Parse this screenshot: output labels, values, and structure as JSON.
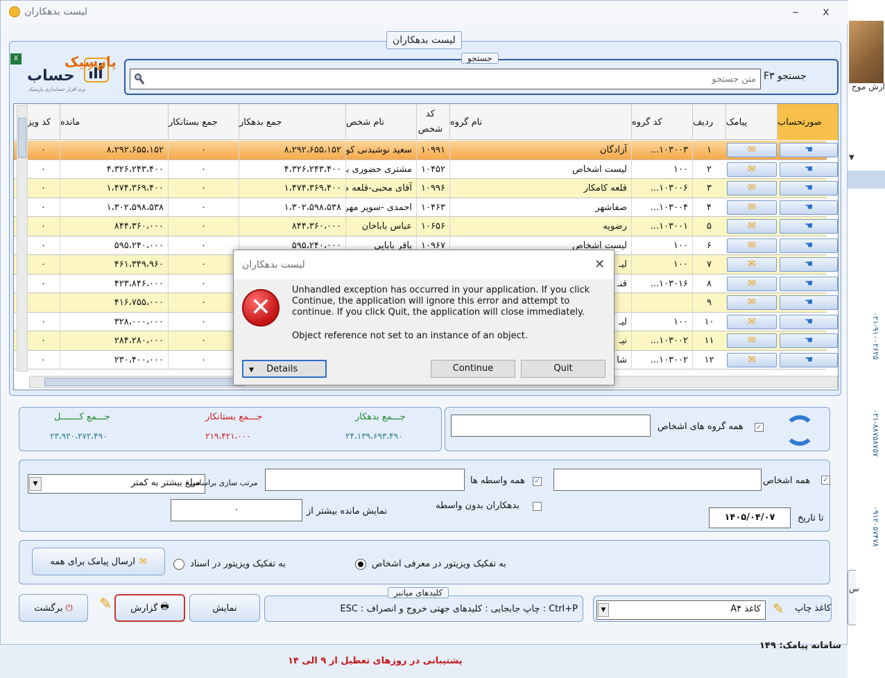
{
  "window": {
    "title": "لیست بدهکاران",
    "min": "–",
    "close": "x"
  },
  "side": {
    "text1": "ارش موج",
    "num1": "۰۲۱-۹۱۰۰۲۶۲۵",
    "num2": "۰۲۱-۸۸۷۵۸۷۵۷",
    "num3": "۰۹۱۲۰۵۷۴۷۸",
    "s": "س"
  },
  "logo": {
    "word1": "پارسیک",
    "word2": "حساب",
    "tag": "نرم افزار حسابداری پارسیک"
  },
  "group": {
    "list_title": "لیست بدهکاران",
    "search_title": "جستجو"
  },
  "search": {
    "label": "جستجو F۳",
    "placeholder": "متن جستجو"
  },
  "columns": [
    "صورتحساب",
    "پیامک",
    "ردیف",
    "کد گروه",
    "نام گروه",
    "کد شخص",
    "نام شخص",
    "جمع بدهکار",
    "جمع بستانکار",
    "مانده",
    "کد ویز"
  ],
  "rows": [
    {
      "row": "۱",
      "gcode": "۱۰۳۰۰۳...",
      "gname": "آزادگان",
      "pcode": "۱۰۹۹۱",
      "pname": "سعید نوشیدنی کوه ...",
      "debit": "۸،۲۹۲،۶۵۵،۱۵۲",
      "credit": "۰",
      "balance": "۸،۲۹۲،۶۵۵،۱۵۲",
      "vcode": "۰"
    },
    {
      "row": "۲",
      "gcode": "۱۰۰",
      "gname": "لیست اشخاص",
      "pcode": "۱۰۴۵۲",
      "pname": "مشتری حضوری بنکد...",
      "debit": "۴،۳۲۶،۲۴۳،۴۰۰",
      "credit": "۰",
      "balance": "۴،۳۲۶،۲۴۳،۴۰۰",
      "vcode": "۰"
    },
    {
      "row": "۳",
      "gcode": "۱۰۳۰۰۶...",
      "gname": "قلعه کامکار",
      "pcode": "۱۰۹۹۶",
      "pname": "آقای محبی-قلعه صد...",
      "debit": "۱،۴۷۴،۳۶۹،۴۰۰",
      "credit": "۰",
      "balance": "۱،۴۷۴،۳۶۹،۴۰۰",
      "vcode": "۰"
    },
    {
      "row": "۴",
      "gcode": "۱۰۳۰۰۴...",
      "gname": "صفاشهر",
      "pcode": "۱۰۴۶۳",
      "pname": "احمدی -سوپر مهرگان",
      "debit": "۱،۳۰۲،۵۹۸،۵۳۸",
      "credit": "۰",
      "balance": "۱،۳۰۲،۵۹۸،۵۳۸",
      "vcode": "۰"
    },
    {
      "row": "۵",
      "gcode": "۱۰۳۰۰۱...",
      "gname": "رضویه",
      "pcode": "۱۰۶۵۶",
      "pname": "عباس باباخان",
      "debit": "۸۴۴،۳۶۰،۰۰۰",
      "credit": "۰",
      "balance": "۸۴۴،۳۶۰،۰۰۰",
      "vcode": "۰"
    },
    {
      "row": "۶",
      "gcode": "۱۰۰",
      "gname": "لیست اشخاص",
      "pcode": "۱۰۹۶۷",
      "pname": "باقر بابایی",
      "debit": "۵۹۵،۲۴۰،۰۰۰",
      "credit": "۰",
      "balance": "۵۹۵،۲۴۰،۰۰۰",
      "vcode": "۰"
    },
    {
      "row": "۷",
      "gcode": "۱۰۰",
      "gname": "لیـ",
      "pcode": "",
      "pname": "",
      "debit": "",
      "credit": "۰",
      "balance": "۴۶۱،۳۴۹،۹۶۰",
      "vcode": "۰"
    },
    {
      "row": "۸",
      "gcode": "۱۰۳۰۱۶...",
      "gname": "قنـ",
      "pcode": "",
      "pname": "",
      "debit": "",
      "credit": "۰",
      "balance": "۴۲۳،۸۴۶،۰۰۰",
      "vcode": "۰"
    },
    {
      "row": "۹",
      "gcode": "",
      "gname": "",
      "pcode": "",
      "pname": "",
      "debit": "",
      "credit": "۰",
      "balance": "۴۱۶،۷۵۵،۰۰۰",
      "vcode": ""
    },
    {
      "row": "۱۰",
      "gcode": "۱۰۰",
      "gname": "لیـ",
      "pcode": "",
      "pname": "",
      "debit": "",
      "credit": "۰",
      "balance": "۳۲۸،۰۰۰،۰۰۰",
      "vcode": "۰"
    },
    {
      "row": "۱۱",
      "gcode": "۱۰۳۰۰۲...",
      "gname": "نیـ",
      "pcode": "",
      "pname": "",
      "debit": "",
      "credit": "۰",
      "balance": "۲۸۴،۲۸۰،۰۰۰",
      "vcode": "۰"
    },
    {
      "row": "۱۲",
      "gcode": "۱۰۳۰۰۲...",
      "gname": "شا",
      "pcode": "",
      "pname": "",
      "debit": "",
      "credit": "۰",
      "balance": "۲۳۰،۴۰۰،۰۰۰",
      "vcode": "۰"
    }
  ],
  "dialog": {
    "title": "لیست بدهکاران",
    "message": "Unhandled exception has occurred in your application. If you click Continue, the application will ignore this error and attempt to continue. If you click Quit, the application will close immediately.",
    "detail": "Object reference not set to an instance of an object.",
    "details_btn": "Details",
    "continue_btn": "Continue",
    "quit_btn": "Quit"
  },
  "totals": {
    "total_label": "جـــمع کـــــــل",
    "total_value": "۲۳،۹۲۰،۲۷۲،۴۹۰",
    "credit_label": "جـــمع بستانکار",
    "credit_value": "۲۱۹،۴۲۱،۰۰۰",
    "debit_label": "جـــمع بدهکار",
    "debit_value": "۲۴،۱۳۹،۶۹۳،۴۹۰",
    "credit_color": "#d01e1e",
    "debit_color": "#1f8a2e"
  },
  "filters": {
    "all_groups": "همه گروه های اشخاص",
    "all_persons": "همه اشخاص",
    "all_intermediaries": "همه واسطه ها",
    "sort_label": "مرتب سازی براساس",
    "sort_value": "مبلغ بیشتر به کمتر",
    "no_intermediary": "بدهکاران بدون واسطه",
    "show_balance_label": "نمایش مانده بیشتر از",
    "show_balance_value": "۰",
    "date_label": "تا تاریخ",
    "date_value": "۱۴۰۵/۰۴/۰۷",
    "radio_persons": "به تفکیک ویزیتور در معرفی اشخاص",
    "radio_docs": "به تفکیک ویزیتور در اسناد"
  },
  "actions": {
    "send_sms": "ارسال پیامک برای همه",
    "back": "برگشت",
    "report": "گزارش",
    "show": "نمایش",
    "shortcuts_title": "کلیدهای میانبر",
    "shortcuts_text": "Ctrl+P : چاپ   جابجایی : کلیدهای جهتی   خروج و انصراف : ESC",
    "print_paper_label": "کاغذ چاپ",
    "paper_value": "کاغذ A۴"
  },
  "footer": {
    "support": "پشتیبانی در روزهای تعطیل از ۹ الی ۱۴",
    "sms_line": "سامانه پیامک: ۱۴۹"
  },
  "colors": {
    "accent": "#2a5aa7",
    "selected_header": "#f7c04a",
    "row_even": "#fbf6c2"
  }
}
